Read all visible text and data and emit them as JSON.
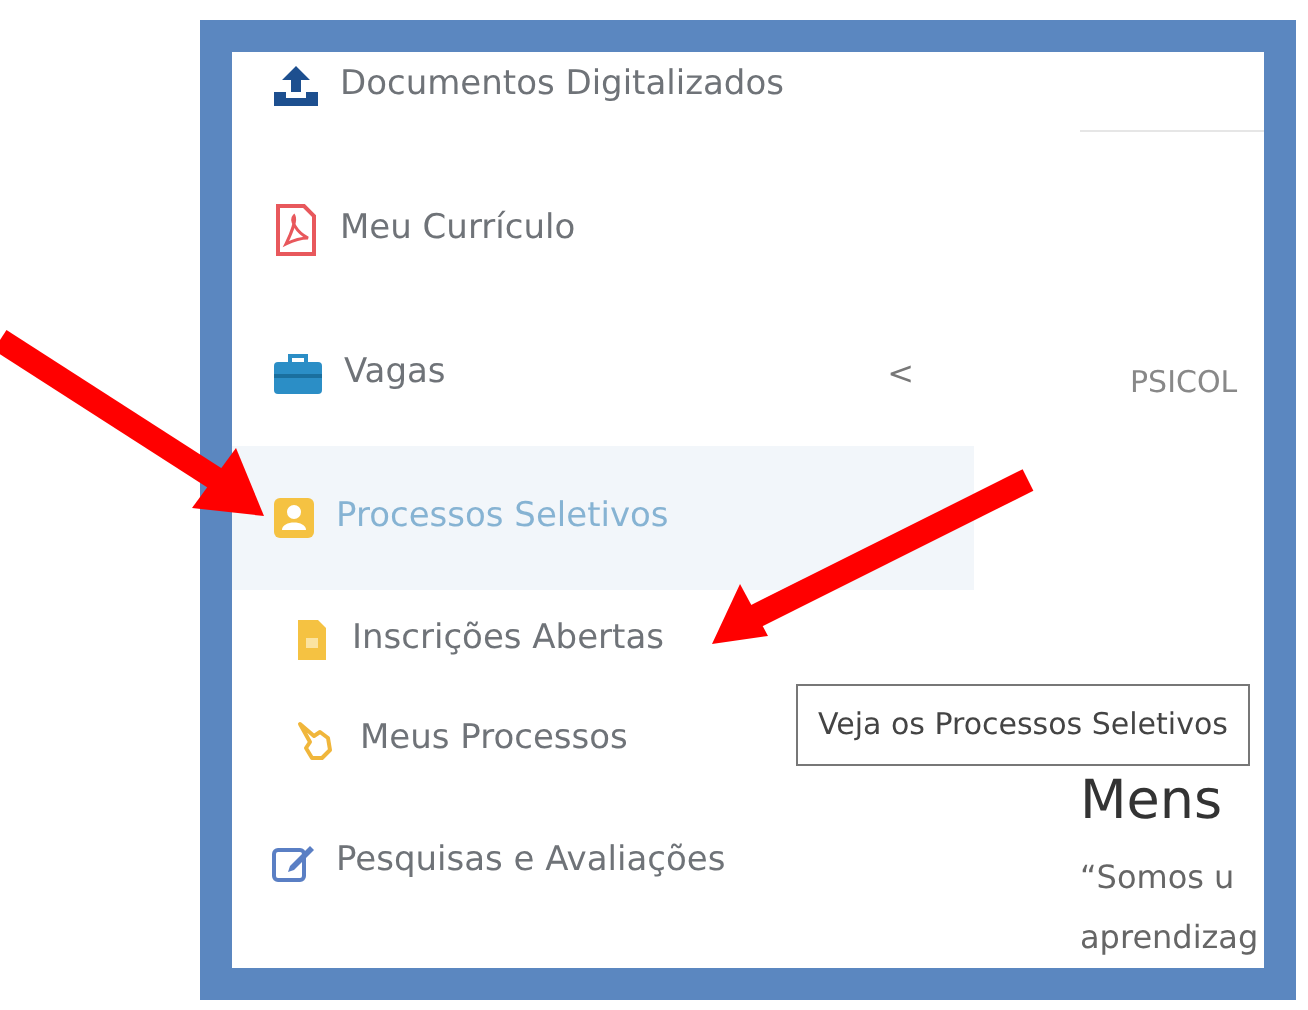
{
  "sidebar": {
    "items": [
      {
        "label": "Documentos Digitalizados",
        "selected": false
      },
      {
        "label": "Meu Currículo",
        "selected": false
      },
      {
        "label": "Vagas",
        "selected": false,
        "chevron": "<"
      },
      {
        "label": "Processos Seletivos",
        "selected": true,
        "children": [
          {
            "label": "Inscrições Abertas"
          },
          {
            "label": "Meus Processos"
          }
        ]
      },
      {
        "label": "Pesquisas e Avaliações",
        "selected": false
      }
    ]
  },
  "main": {
    "category": "PSICOL",
    "heading": "Mens",
    "paragraph_lines": [
      "“Somos u",
      "aprendizag"
    ]
  },
  "tooltip": {
    "text": "Veja os Processos Seletivos"
  }
}
